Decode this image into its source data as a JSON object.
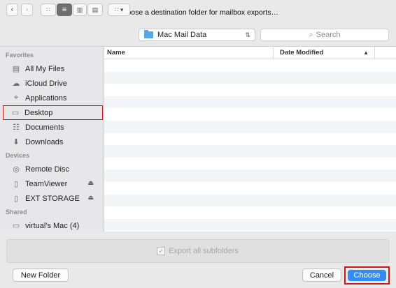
{
  "window": {
    "title": "Choose a destination folder for mailbox exports…"
  },
  "toolbar": {
    "back_icon": "chevron-left-icon",
    "forward_icon": "chevron-right-icon",
    "location": "Mac Mail Data",
    "search_placeholder": "Search"
  },
  "sidebar": {
    "favorites_label": "Favorites",
    "favorites": [
      {
        "label": "All My Files",
        "icon": "all-files-icon"
      },
      {
        "label": "iCloud Drive",
        "icon": "cloud-icon"
      },
      {
        "label": "Applications",
        "icon": "applications-icon"
      },
      {
        "label": "Desktop",
        "icon": "desktop-icon"
      },
      {
        "label": "Documents",
        "icon": "documents-icon"
      },
      {
        "label": "Downloads",
        "icon": "downloads-icon"
      }
    ],
    "devices_label": "Devices",
    "devices": [
      {
        "label": "Remote Disc",
        "icon": "disc-icon"
      },
      {
        "label": "TeamViewer",
        "icon": "drive-icon"
      },
      {
        "label": "EXT STORAGE",
        "icon": "drive-icon"
      }
    ],
    "shared_label": "Shared",
    "shared": [
      {
        "label": "virtual's Mac (4)",
        "icon": "computer-icon"
      }
    ]
  },
  "list": {
    "columns": [
      "Name",
      "Date Modified"
    ]
  },
  "options": {
    "export_subfolders": "Export all subfolders"
  },
  "footer": {
    "new_folder": "New Folder",
    "cancel": "Cancel",
    "choose": "Choose"
  },
  "colors": {
    "accent": "#2f8df4",
    "highlight": "#c81a1a"
  }
}
